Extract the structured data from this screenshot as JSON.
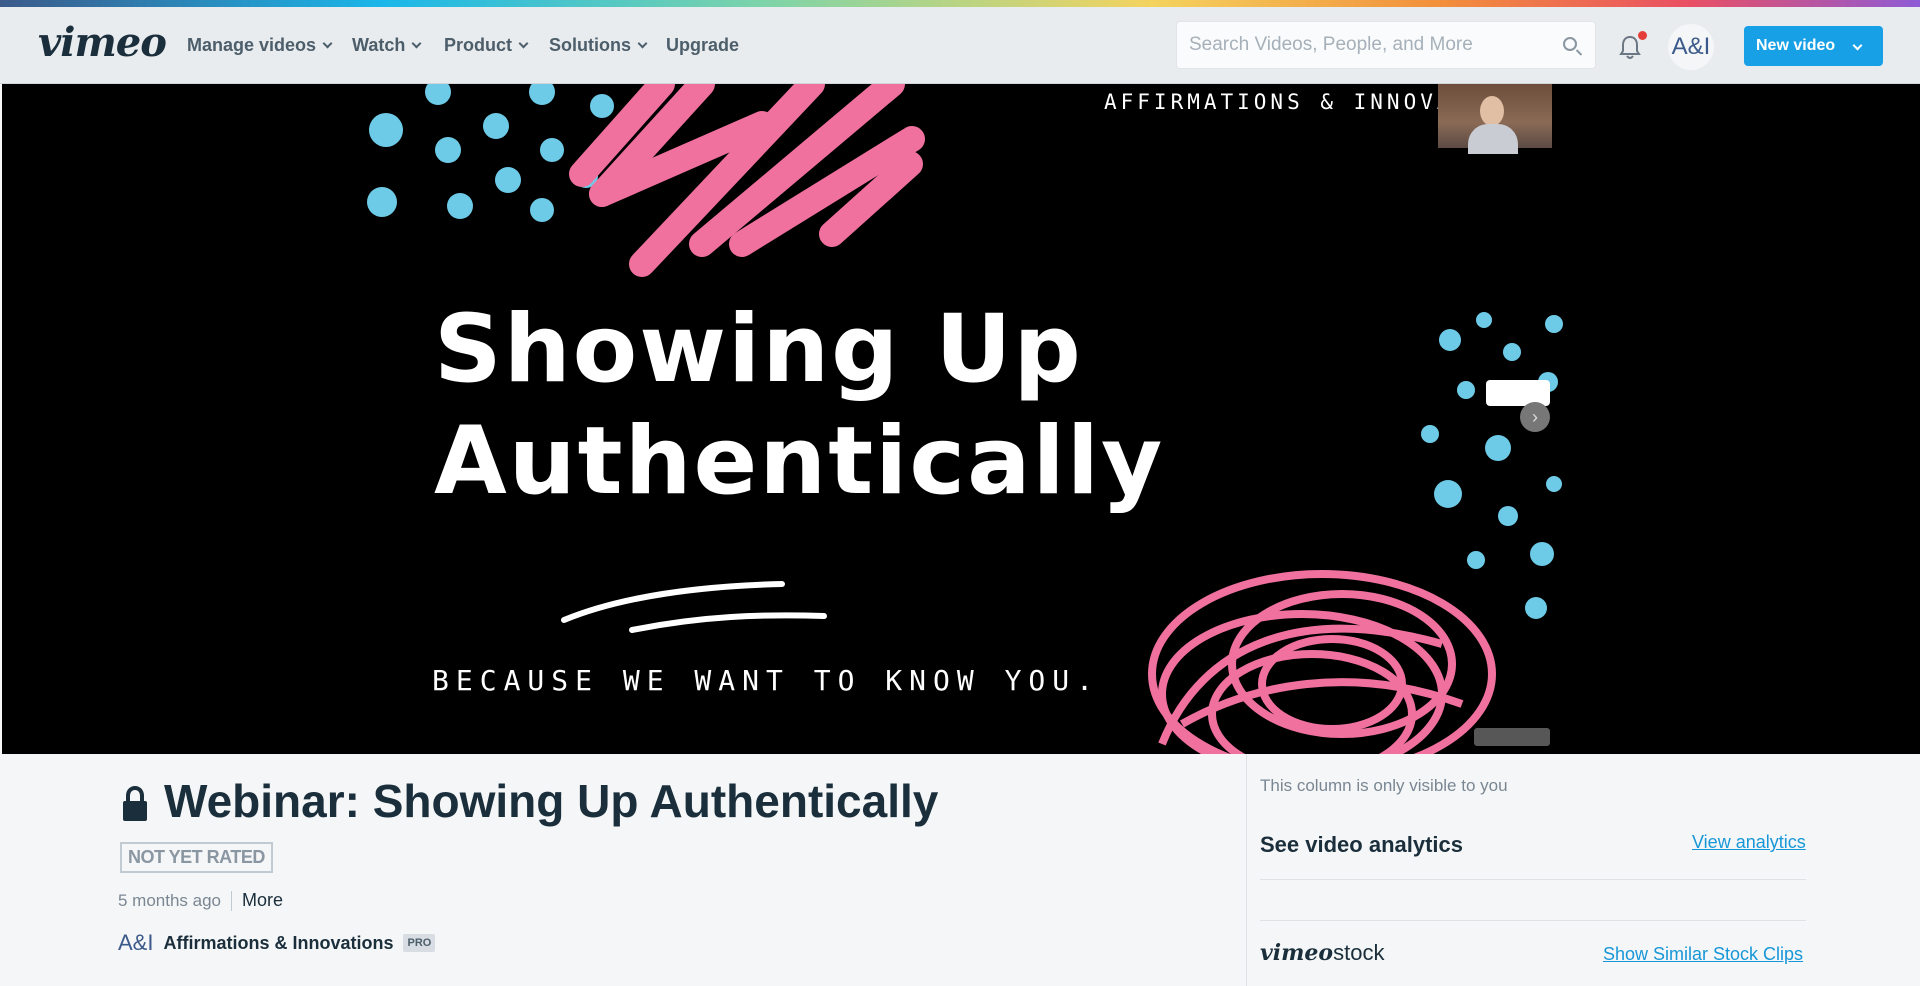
{
  "nav": {
    "logo": "vimeo",
    "items": [
      {
        "label": "Manage videos",
        "dropdown": true
      },
      {
        "label": "Watch",
        "dropdown": true
      },
      {
        "label": "Product",
        "dropdown": true
      },
      {
        "label": "Solutions",
        "dropdown": true
      },
      {
        "label": "Upgrade",
        "dropdown": false
      }
    ],
    "search_placeholder": "Search Videos, People, and More",
    "avatar_text": "A&I",
    "new_video_label": "New video",
    "accent_color": "#17a0e6"
  },
  "player": {
    "slide_heading_line1": "Showing Up",
    "slide_heading_line2": "Authentically",
    "slide_tagline": "BECAUSE WE WANT TO KNOW YOU.",
    "slide_header_text": "AFFIRMATIONS & INNOVA",
    "next_icon": "chevron-right-icon",
    "colors": {
      "pink": "#f0709e",
      "blue": "#6dcbe8",
      "background": "#000000"
    }
  },
  "video": {
    "title": "Webinar: Showing Up Authentically",
    "rating": "NOT YET RATED",
    "age": "5 months ago",
    "more_label": "More",
    "owner_logo_text": "A&I",
    "owner_name": "Affirmations & Innovations",
    "owner_badge": "PRO"
  },
  "sidebar": {
    "note": "This column is only visible to you",
    "analytics_heading": "See video analytics",
    "analytics_link": "View analytics",
    "stock_brand_part1": "vimeo",
    "stock_brand_part2": "stock",
    "stock_link": "Show Similar Stock Clips"
  }
}
